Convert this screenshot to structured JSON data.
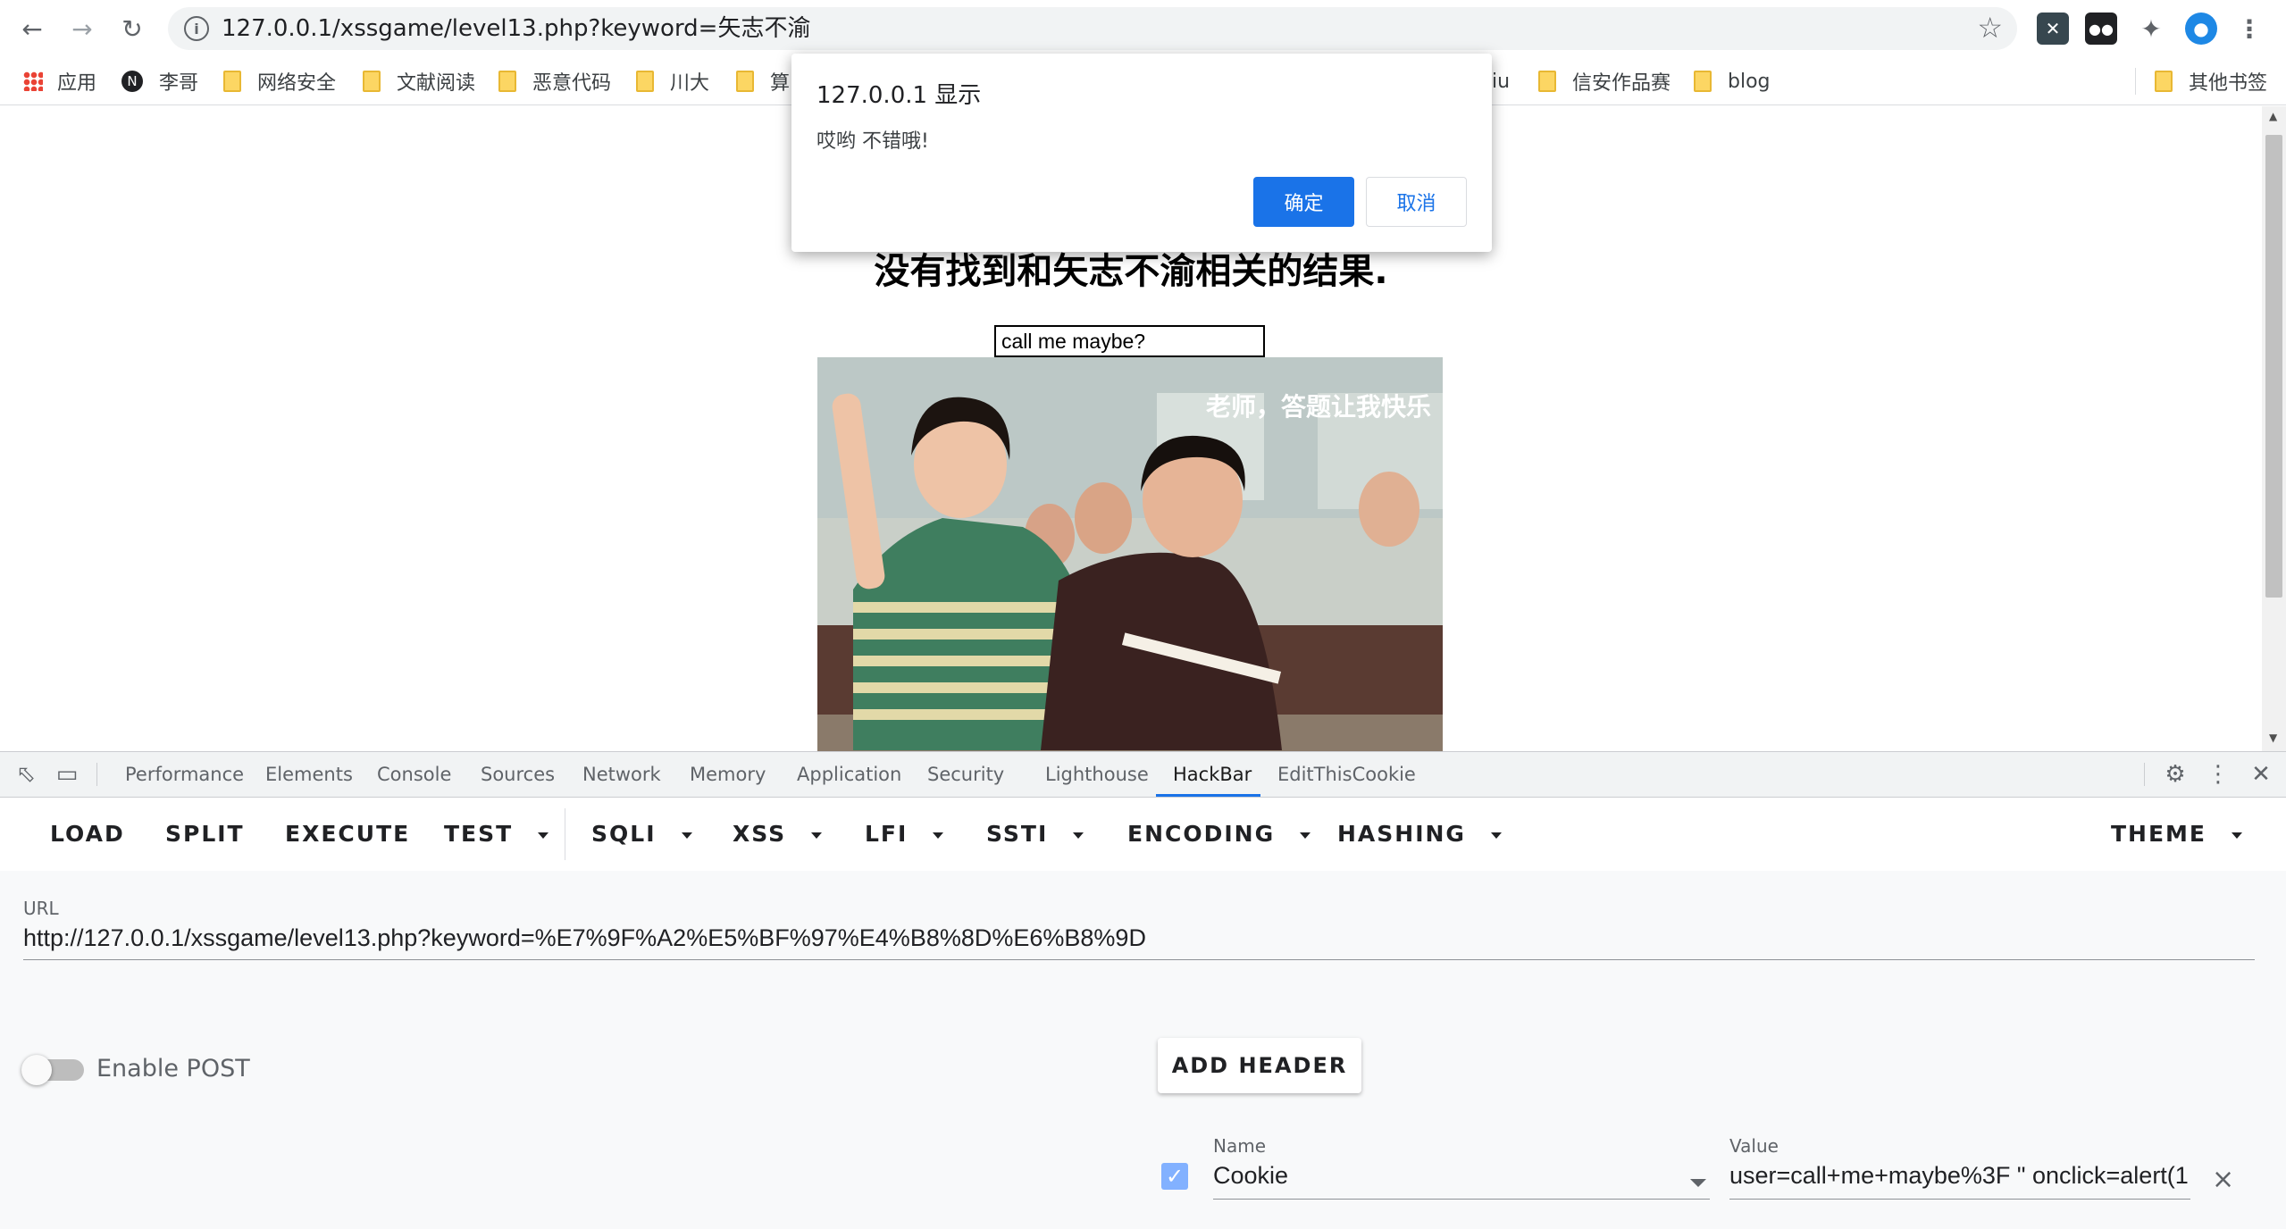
{
  "browser": {
    "url": "127.0.0.1/xssgame/level13.php?keyword=矢志不渝",
    "bookmarks": {
      "apps": "应用",
      "items": [
        "李哥",
        "网络安全",
        "文献阅读",
        "恶意代码",
        "川大",
        "算",
        "iu",
        "信安作品赛",
        "blog"
      ],
      "other": "其他书签"
    },
    "icons": [
      "back-icon",
      "forward-icon",
      "reload-icon",
      "info-icon",
      "star-icon",
      "extension-icon",
      "puzzle-icon",
      "profile-icon",
      "menu-icon"
    ]
  },
  "page": {
    "heading": "没有找到和矢志不渝相关的结果.",
    "input_value": "call me maybe? ",
    "meme_caption": "老师，答题让我快乐"
  },
  "dialog": {
    "title": "127.0.0.1 显示",
    "message": "哎哟 不错哦!",
    "ok_label": "确定",
    "cancel_label": "取消"
  },
  "devtools": {
    "tabs": [
      "Performance",
      "Elements",
      "Console",
      "Sources",
      "Network",
      "Memory",
      "Application",
      "Security",
      "Lighthouse",
      "HackBar",
      "EditThisCookie"
    ],
    "active_tab": "HackBar"
  },
  "hackbar": {
    "menu": [
      "LOAD",
      "SPLIT",
      "EXECUTE",
      "TEST",
      "SQLI",
      "XSS",
      "LFI",
      "SSTI",
      "ENCODING",
      "HASHING"
    ],
    "theme": "THEME",
    "url_label": "URL",
    "url_value": "http://127.0.0.1/xssgame/level13.php?keyword=%E7%9F%A2%E5%BF%97%E4%B8%8D%E6%B8%9D",
    "post_label": "Enable POST",
    "post_enabled": false,
    "add_header_label": "ADD HEADER",
    "header": {
      "name_label": "Name",
      "name_value": "Cookie",
      "value_label": "Value",
      "value_value": "user=call+me+maybe%3F \" onclick=alert(1",
      "enabled": true
    }
  },
  "colors": {
    "accent": "#1a73e8",
    "folder": "#fcd663"
  }
}
